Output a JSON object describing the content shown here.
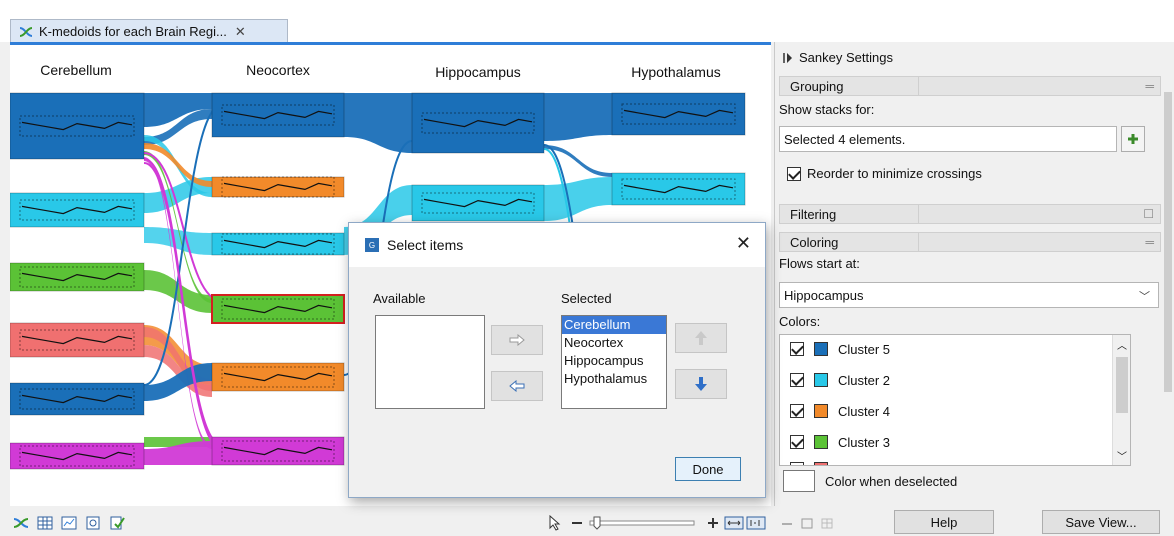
{
  "tab": {
    "title": "K-medoids for each Brain Regi...",
    "close": "✕"
  },
  "chart_data": {
    "type": "sankey",
    "columns": [
      "Cerebellum",
      "Neocortex",
      "Hippocampus",
      "Hypothalamus"
    ],
    "cluster_colors": {
      "Cluster 5": "#1a6fb8",
      "Cluster 2": "#29c8e8",
      "Cluster 4": "#f28a2a",
      "Cluster 3": "#5bc236",
      "Cluster 1": "#f07070",
      "Cluster 6": "#d13ad6"
    }
  },
  "panel": {
    "title": "Sankey Settings",
    "grouping": {
      "header": "Grouping",
      "show_stacks_label": "Show stacks for:",
      "show_stacks_value": "Selected 4 elements.",
      "reorder_label": "Reorder to minimize crossings"
    },
    "filtering": {
      "header": "Filtering"
    },
    "coloring": {
      "header": "Coloring",
      "flows_label": "Flows start at:",
      "flows_value": "Hippocampus",
      "colors_label": "Colors:",
      "items": [
        {
          "label": "Cluster 5",
          "color": "#1a6fb8"
        },
        {
          "label": "Cluster 2",
          "color": "#29c8e8"
        },
        {
          "label": "Cluster 4",
          "color": "#f28a2a"
        },
        {
          "label": "Cluster 3",
          "color": "#5bc236"
        }
      ],
      "deselected_label": "Color when deselected"
    },
    "help_label": "Help",
    "save_view_label": "Save View..."
  },
  "dialog": {
    "title": "Select items",
    "available_label": "Available",
    "selected_label": "Selected",
    "selected_items": [
      "Cerebellum",
      "Neocortex",
      "Hippocampus",
      "Hypothalamus"
    ],
    "done_label": "Done"
  }
}
